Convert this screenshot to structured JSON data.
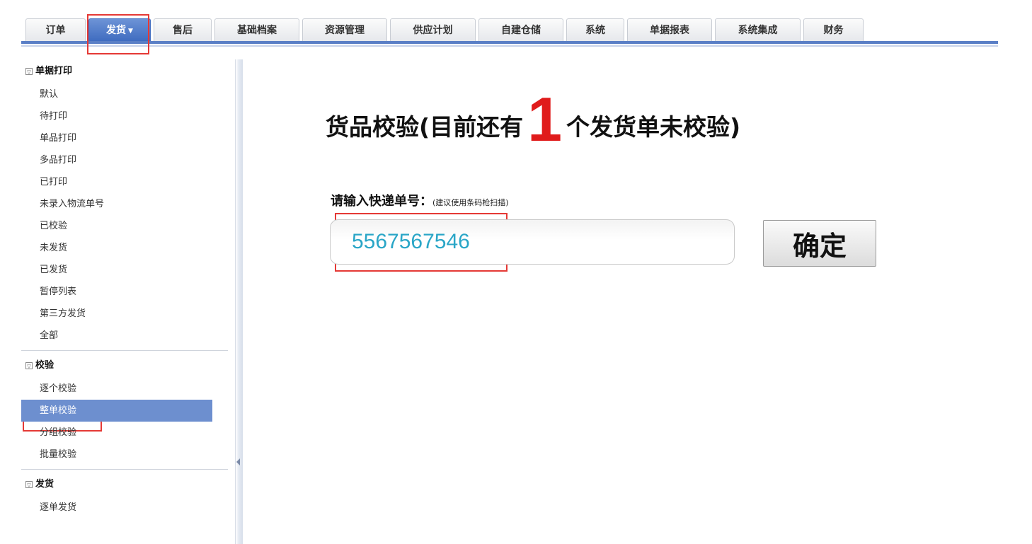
{
  "tabs": [
    {
      "label": "订单"
    },
    {
      "label": "发货"
    },
    {
      "label": "售后"
    },
    {
      "label": "基础档案"
    },
    {
      "label": "资源管理"
    },
    {
      "label": "供应计划"
    },
    {
      "label": "自建仓储"
    },
    {
      "label": "系统"
    },
    {
      "label": "单据报表"
    },
    {
      "label": "系统集成"
    },
    {
      "label": "财务"
    }
  ],
  "active_tab": "发货",
  "sidebar": {
    "groups": [
      {
        "title": "单据打印",
        "items": [
          "默认",
          "待打印",
          "单品打印",
          "多品打印",
          "已打印",
          "未录入物流单号",
          "已校验",
          "未发货",
          "已发货",
          "暂停列表",
          "第三方发货",
          "全部"
        ]
      },
      {
        "title": "校验",
        "items": [
          "逐个校验",
          "整单校验",
          "分组校验",
          "批量校验"
        ]
      },
      {
        "title": "发货",
        "items": [
          "逐单发货"
        ]
      }
    ],
    "selected_item": "整单校验"
  },
  "main": {
    "heading_prefix": "货品校验(目前还有",
    "pending_count": "1",
    "heading_suffix": "个发货单未校验)",
    "prompt_label": "请输入快递单号：",
    "prompt_hint": "(建议使用条码枪扫描)",
    "tracking_number": "5567567546",
    "confirm_label": "确定"
  },
  "colors": {
    "accent_blue": "#5a7fc6",
    "active_tab": "#4a76c6",
    "selected_item": "#6d8fcf",
    "count_red": "#e01b1b",
    "input_text": "#2aa6c7",
    "highlight_red": "#e53935"
  }
}
